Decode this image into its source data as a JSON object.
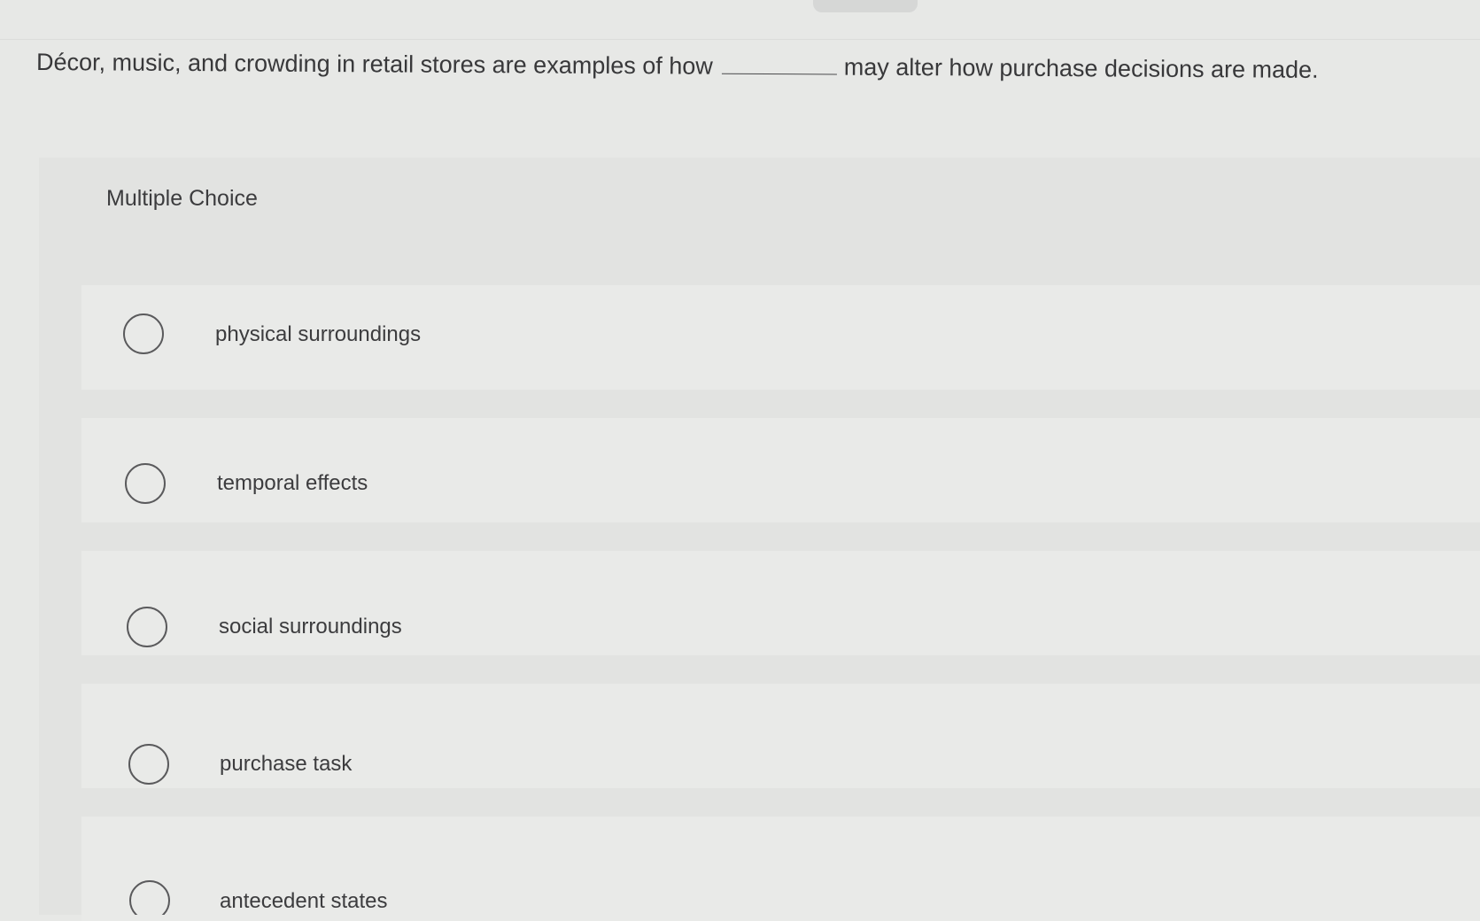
{
  "question": {
    "before_blank": "Décor, music, and crowding in retail stores are examples of how",
    "after_blank": "may alter how purchase decisions are made."
  },
  "multiple_choice": {
    "heading": "Multiple Choice",
    "options": [
      {
        "label": "physical surroundings",
        "selected": false
      },
      {
        "label": "temporal effects",
        "selected": false
      },
      {
        "label": "social surroundings",
        "selected": false
      },
      {
        "label": "purchase task",
        "selected": false
      },
      {
        "label": "antecedent states",
        "selected": false
      }
    ]
  },
  "colors": {
    "background": "#e7e8e6",
    "panel": "#e2e3e1",
    "text": "#3a3a3c",
    "radio_border": "#5a5a5c"
  }
}
